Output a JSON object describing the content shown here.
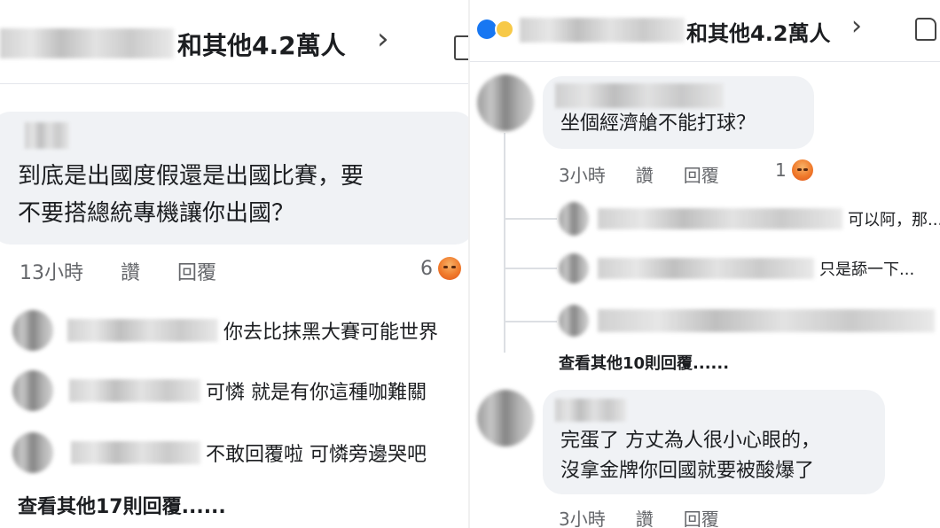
{
  "left": {
    "header": {
      "reactions_text": "和其他4.2萬人",
      "chevron": "chevron-right-icon"
    },
    "comment": {
      "line1": "到底是出國度假還是出國比賽，要",
      "line2": "不要搭總統專機讓你出國？",
      "time": "13小時",
      "like": "讚",
      "reply": "回覆",
      "reaction_count": "6"
    },
    "replies": [
      {
        "text": "你去比抹黑大賽可能世界"
      },
      {
        "text": "可憐 就是有你這種咖難關"
      },
      {
        "text": "不敢回覆啦 可憐旁邊哭吧"
      }
    ],
    "see_more": "查看其他17則回覆......"
  },
  "right": {
    "header": {
      "reactions_text": "和其他4.2萬人",
      "chevron": "chevron-right-icon",
      "like_icon": "thumbs-up-icon"
    },
    "comment1": {
      "text": "坐個經濟艙不能打球？",
      "time": "3小時",
      "like": "讚",
      "reply": "回覆",
      "reaction_count": "1"
    },
    "replies": [
      {
        "text": "可以阿，那..."
      },
      {
        "text": "只是舔一下..."
      },
      {
        "text": ""
      }
    ],
    "see_more": "查看其他10則回覆......",
    "comment2": {
      "line1": "完蛋了 方丈為人很小心眼的，",
      "line2": "沒拿金牌你回國就要被酸爆了",
      "time": "3小時",
      "like": "讚",
      "reply": "回覆"
    }
  }
}
